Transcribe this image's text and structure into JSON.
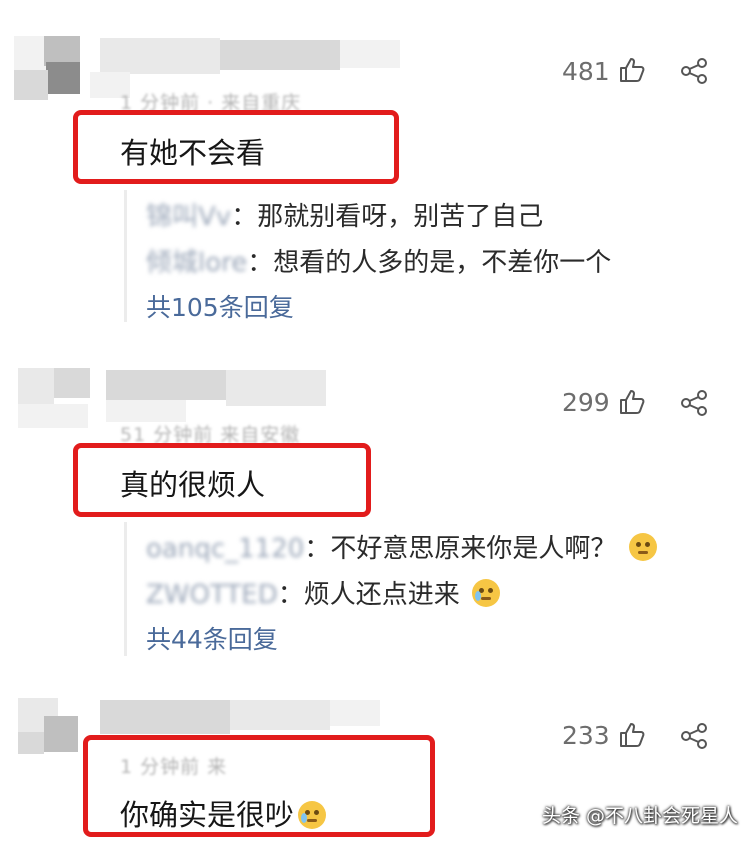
{
  "comments": [
    {
      "likes": "481",
      "meta": "1 分钟前 · 来自重庆",
      "text": "有她不会看",
      "replies": [
        {
          "user": "锦叫Vv",
          "text": "那就别看呀，别苦了自己"
        },
        {
          "user": "倾城lore",
          "text": "想看的人多的是，不差你一个"
        }
      ],
      "more": "共105条回复"
    },
    {
      "likes": "299",
      "meta": "51 分钟前  来自安徽",
      "text": "真的很烦人",
      "replies": [
        {
          "user": "oanqc_1120",
          "text": "不好意思原来你是人啊？",
          "emoji": "thinking-emoji"
        },
        {
          "user": "ZWOTTED",
          "text": "烦人还点进来",
          "emoji": "crying-emoji"
        }
      ],
      "more": "共44条回复"
    },
    {
      "likes": "233",
      "meta": "1 分钟前 来",
      "text": "你确实是很吵",
      "emoji": "laughing-crying-emoji"
    }
  ],
  "watermark": "头条 @不八卦会死星人",
  "colors": {
    "highlight": "#e21c1c",
    "link": "#4a6a9a",
    "count": "#6d6d6d"
  },
  "icons": [
    "like-icon",
    "share-icon"
  ]
}
